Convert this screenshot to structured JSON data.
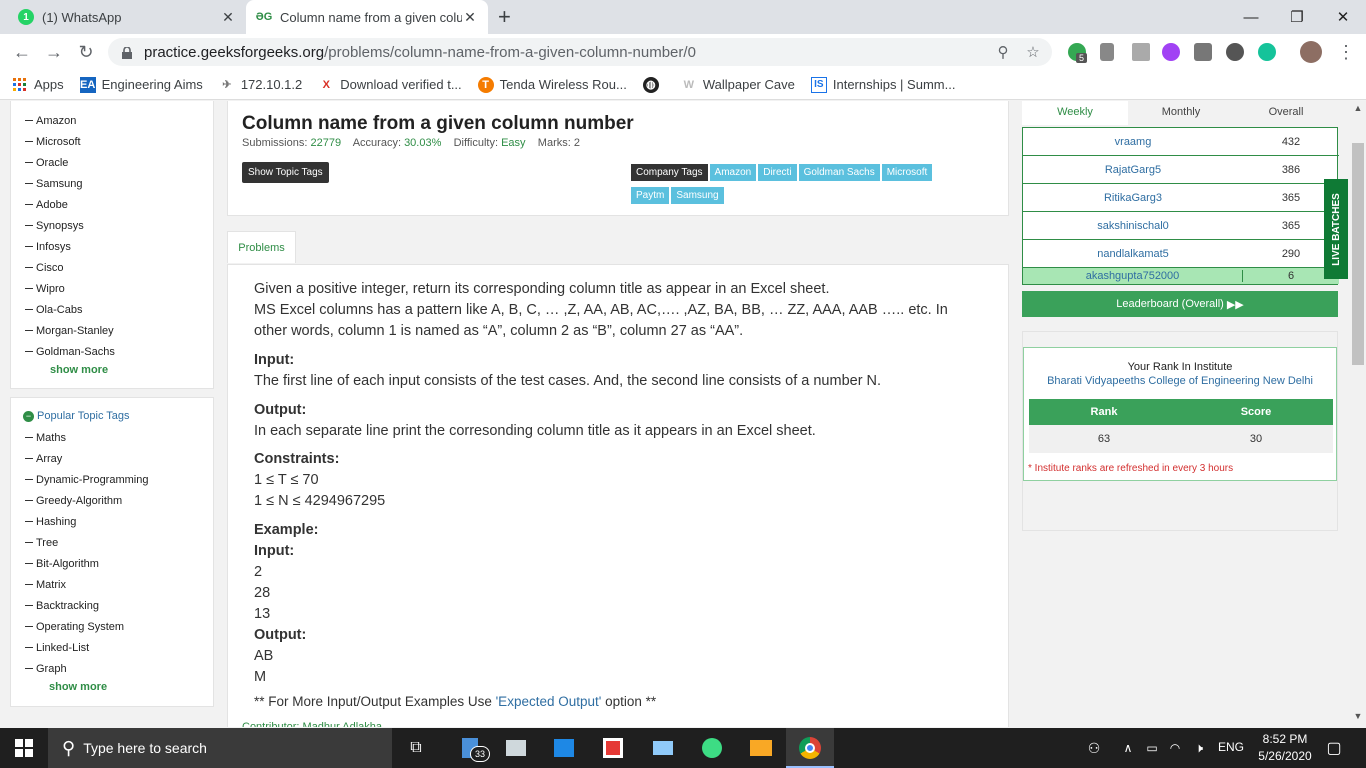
{
  "browser": {
    "tabs": [
      {
        "title": "(1) WhatsApp",
        "close": "✕"
      },
      {
        "title": "Column name from a given colum",
        "close": "✕"
      }
    ],
    "new_tab": "+",
    "window": {
      "minimize": "—",
      "maximize": "❐",
      "close": "✕"
    },
    "url_host": "practice.geeksforgeeks.org",
    "url_path": "/problems/column-name-from-a-given-column-number/0",
    "extension_badge": "5",
    "bookmarks": [
      {
        "label": "Apps",
        "icon": "apps-grid-icon"
      },
      {
        "label": "Engineering Aims",
        "icon": "ea-icon"
      },
      {
        "label": "172.10.1.2",
        "icon": "plane-icon"
      },
      {
        "label": "Download verified t...",
        "icon": "x-icon"
      },
      {
        "label": "Tenda Wireless Rou...",
        "icon": "tenda-icon"
      },
      {
        "label": "",
        "icon": "globe-icon"
      },
      {
        "label": "Wallpaper Cave",
        "icon": "w-icon"
      },
      {
        "label": "Internships | Summ...",
        "icon": "is-icon"
      }
    ]
  },
  "sidebar": {
    "companies": [
      "Amazon",
      "Microsoft",
      "Oracle",
      "Samsung",
      "Adobe",
      "Synopsys",
      "Infosys",
      "Cisco",
      "Wipro",
      "Ola-Cabs",
      "Morgan-Stanley",
      "Goldman-Sachs"
    ],
    "show_more_1": "show more",
    "popular_title": "Popular Topic Tags",
    "topics": [
      "Maths",
      "Array",
      "Dynamic-Programming",
      "Greedy-Algorithm",
      "Hashing",
      "Tree",
      "Bit-Algorithm",
      "Matrix",
      "Backtracking",
      "Operating System",
      "Linked-List",
      "Graph"
    ],
    "show_more_2": "show more"
  },
  "problem": {
    "title": "Column name from a given column number",
    "submissions_label": "Submissions:",
    "submissions": "22779",
    "accuracy_label": "Accuracy:",
    "accuracy": "30.03%",
    "difficulty_label": "Difficulty:",
    "difficulty": "Easy",
    "marks_label": "Marks:",
    "marks": "2",
    "show_topic_tags": "Show Topic Tags",
    "company_tags_label": "Company Tags",
    "company_tags": [
      "Amazon",
      "Directi",
      "Goldman Sachs",
      "Microsoft",
      "Paytm",
      "Samsung"
    ],
    "tab_problems": "Problems",
    "statement_1": "Given a positive integer, return its corresponding column title as appear in an Excel sheet.",
    "statement_2": "MS Excel columns has a pattern like A, B, C, … ,Z, AA, AB, AC,…. ,AZ, BA, BB, … ZZ, AAA, AAB ….. etc. In other words, column 1 is named as “A”, column 2 as “B”, column 27 as “AA”.",
    "input_h": "Input:",
    "input_text": "The first line of each input consists of the test cases. And, the second line consists of a number N.",
    "output_h": "Output:",
    "output_text": "In each separate line print the corresonding column title as it appears in an Excel sheet.",
    "constraints_h": "Constraints:",
    "constraint_1": "1 ≤ T ≤ 70",
    "constraint_2": "1 ≤ N ≤ 4294967295",
    "example_h": "Example:",
    "ex_input_h": "Input:",
    "ex_input": [
      "2",
      "28",
      "13"
    ],
    "ex_output_h": "Output:",
    "ex_output": [
      "AB",
      "M"
    ],
    "more_prefix": "** For More Input/Output Examples Use ",
    "more_link": "'Expected Output'",
    "more_suffix": " option **",
    "contributor": "Contributor: Madhur Adlakha"
  },
  "leaderboard": {
    "tabs": [
      "Weekly",
      "Monthly",
      "Overall"
    ],
    "rows": [
      {
        "name": "vraamg",
        "score": "432"
      },
      {
        "name": "RajatGarg5",
        "score": "386"
      },
      {
        "name": "RitikaGarg3",
        "score": "365"
      },
      {
        "name": "sakshinischal0",
        "score": "365"
      },
      {
        "name": "nandlalkamat5",
        "score": "290"
      }
    ],
    "me": {
      "name": "akashgupta752000",
      "score": "6"
    },
    "overall_button": "Leaderboard (Overall)",
    "live_batches": "LIVE BATCHES"
  },
  "rank": {
    "title": "Your Rank In Institute",
    "institute": "Bharati Vidyapeeths College of Engineering New Delhi",
    "col_rank": "Rank",
    "col_score": "Score",
    "rank": "63",
    "score": "30",
    "note": "* Institute ranks are refreshed in every 3 hours"
  },
  "taskbar": {
    "search_placeholder": "Type here to search",
    "badge": "33",
    "lang": "ENG",
    "time": "8:52 PM",
    "date": "5/26/2020"
  },
  "colors": {
    "gfg_green": "#2f8d46",
    "tag_blue": "#5bc0de",
    "link_blue": "#2f6ea2"
  }
}
